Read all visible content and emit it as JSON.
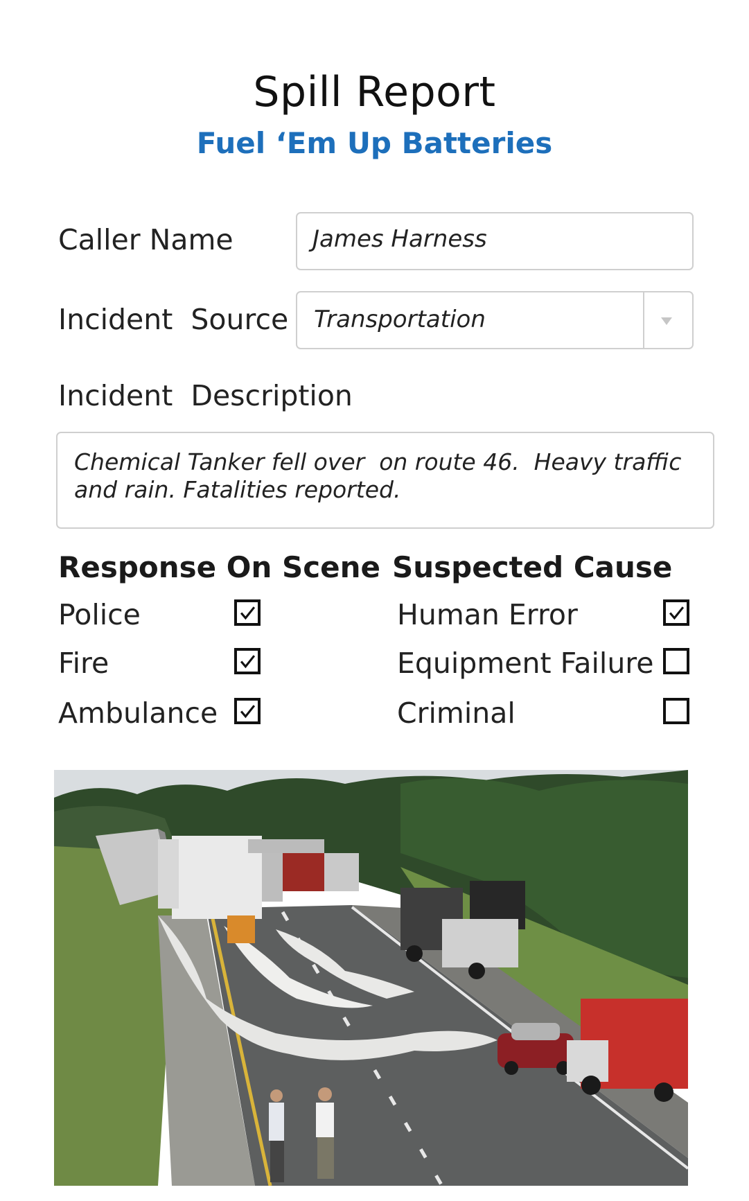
{
  "header": {
    "title": "Spill Report",
    "subtitle": "Fuel ‘Em Up Batteries"
  },
  "form": {
    "caller_name_label": "Caller Name",
    "caller_name_value": "James Harness",
    "incident_source_label": "Incident  Source",
    "incident_source_value": "Transportation",
    "incident_description_label": "Incident  Description",
    "incident_description_value": "Chemical Tanker fell over  on route 46.  Heavy traffic and rain. Fatalities reported."
  },
  "response": {
    "heading": "Response On Scene",
    "items": [
      {
        "label": "Police",
        "checked": true
      },
      {
        "label": "Fire",
        "checked": true
      },
      {
        "label": "Ambulance",
        "checked": true
      }
    ]
  },
  "cause": {
    "heading": "Suspected Cause",
    "items": [
      {
        "label": "Human Error",
        "checked": true
      },
      {
        "label": "Equipment Failure",
        "checked": false
      },
      {
        "label": "Criminal",
        "checked": false
      }
    ]
  },
  "colors": {
    "accent": "#1d6fbb",
    "border": "#cfcfcf"
  },
  "icons": {
    "select": "chevron-down-icon",
    "check": "checkmark-icon"
  }
}
